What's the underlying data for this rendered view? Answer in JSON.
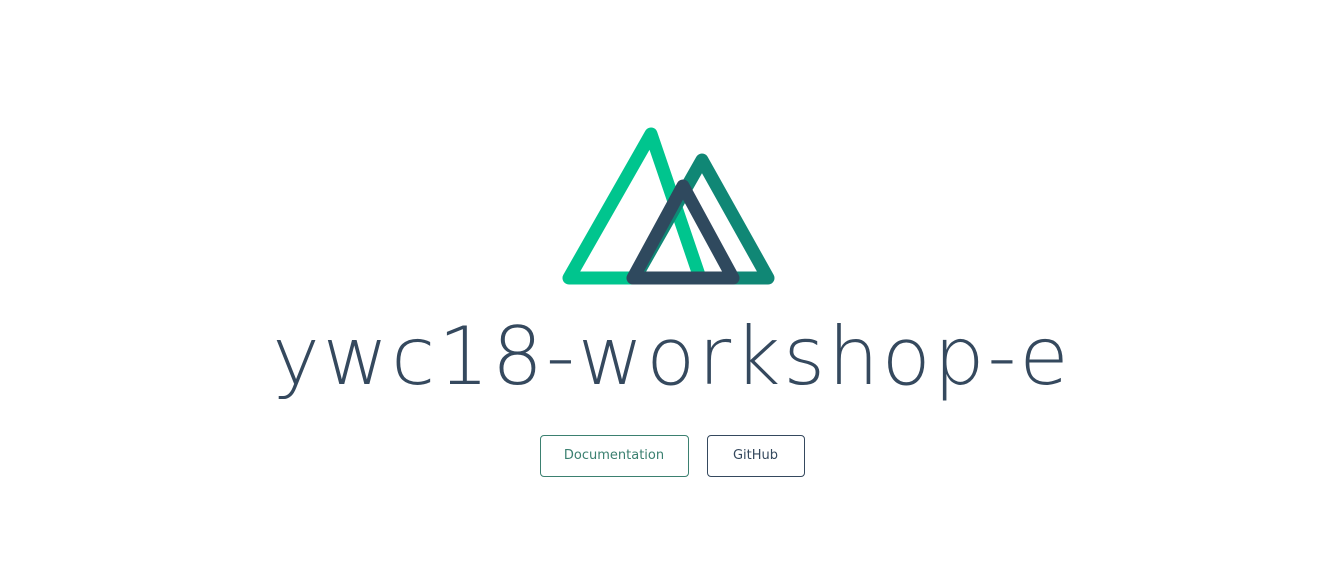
{
  "logo": {
    "icon": "nuxt-logo-icon",
    "colors": {
      "left_triangle": "#00c58e",
      "right_triangle": "#108775",
      "front_triangle": "#2f495e"
    }
  },
  "title": "ywc18-workshop-e",
  "links": {
    "documentation": "Documentation",
    "github": "GitHub"
  },
  "colors": {
    "title": "#35495e",
    "button_green": "#3b8070",
    "button_grey": "#35495e",
    "background": "#ffffff"
  }
}
